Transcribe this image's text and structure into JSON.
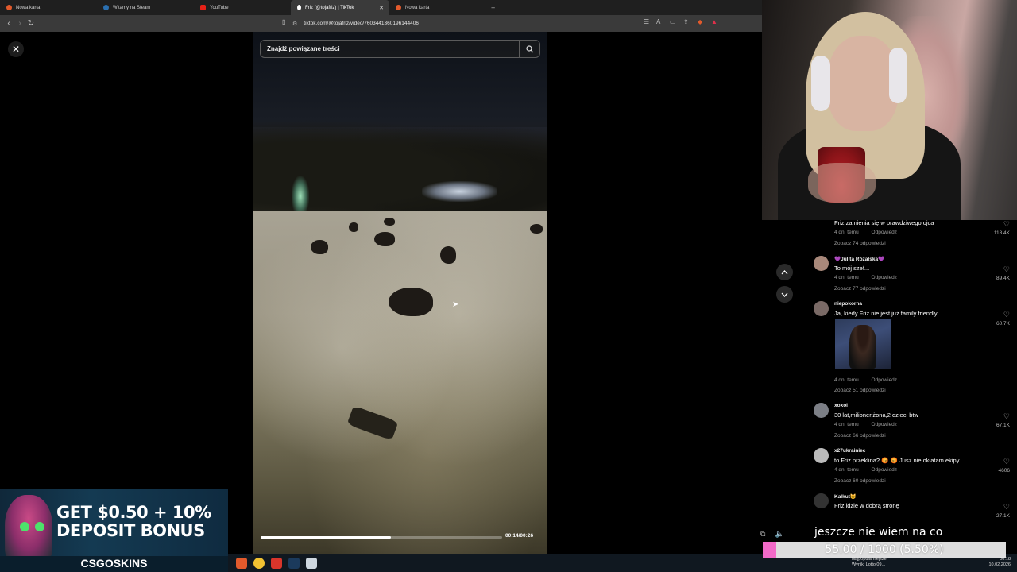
{
  "browser": {
    "tabs": [
      {
        "label": "Nowa karta",
        "favicon_color": "#e25a2c"
      },
      {
        "label": "Witamy na Steam",
        "favicon_color": "#2a6fb0"
      },
      {
        "label": "YouTube",
        "favicon_color": "#e62117"
      },
      {
        "label": "Friz (@tojafriz) | TikTok",
        "favicon_color": "#ffffff",
        "active": true
      },
      {
        "label": "Nowa karta",
        "favicon_color": "#e25a2c"
      }
    ],
    "new_tab_symbol": "+",
    "url": "tiktok.com/@tojafriz/video/7603441360196144406"
  },
  "video": {
    "search_placeholder": "Znajdź powiązane treści",
    "time": "00:14/00:26",
    "progress_fraction": 0.538
  },
  "comments": [
    {
      "name": "",
      "text": "Friz zamienia się w prawdziwego ojca",
      "age": "4 dn. temu",
      "reply": "Odpowiedz",
      "replies": "Zobacz 74 odpowiedzi",
      "likes": "118.4K"
    },
    {
      "name": "💜Julita Różalska💜",
      "text": "To mój szef...",
      "age": "4 dn. temu",
      "reply": "Odpowiedz",
      "replies": "Zobacz 77 odpowiedzi",
      "likes": "89.4K"
    },
    {
      "name": "niepokorna",
      "text": "Ja, kiedy Friz nie jest już family friendly:",
      "age": "4 dn. temu",
      "reply": "Odpowiedz",
      "replies": "Zobacz 51 odpowiedzi",
      "likes": "60.7K"
    },
    {
      "name": "xoxol",
      "text": "30 lat,milioner,żona,2 dzieci btw",
      "age": "4 dn. temu",
      "reply": "Odpowiedz",
      "replies": "Zobacz 66 odpowiedzi",
      "likes": "67.1K"
    },
    {
      "name": "x27ukrainiec",
      "text": "to Friz przeklina? 😡 😡 Jusz nie okłatam ekipy",
      "age": "4 dn. temu",
      "reply": "Odpowiedz",
      "replies": "Zobacz 60 odpowiedzi",
      "likes": "4606"
    },
    {
      "name": "Kalkut😺",
      "text": "Friz idzie w dobrą stronę",
      "age": "",
      "reply": "",
      "replies": "",
      "likes": "27.1K"
    }
  ],
  "ad": {
    "line1": "GET $0.50 + 10%",
    "line2": "DEPOSIT BONUS",
    "brand": "CSGOSKINS"
  },
  "stream": {
    "chat_overlay": "jeszcze nie wiem na co",
    "goal_text": "55.00 / 1000 (5.50%)",
    "goal_fraction": 0.055
  },
  "taskbar": {
    "news_title": "Najpopularniejsze",
    "news_sub": "Wyniki Lotto 09...",
    "time": "00:18",
    "date": "10.02.2026"
  },
  "icons": {
    "close": "✕",
    "search": "⌕",
    "chevron_up": "︿",
    "chevron_down": "﹀",
    "heart": "♡"
  }
}
